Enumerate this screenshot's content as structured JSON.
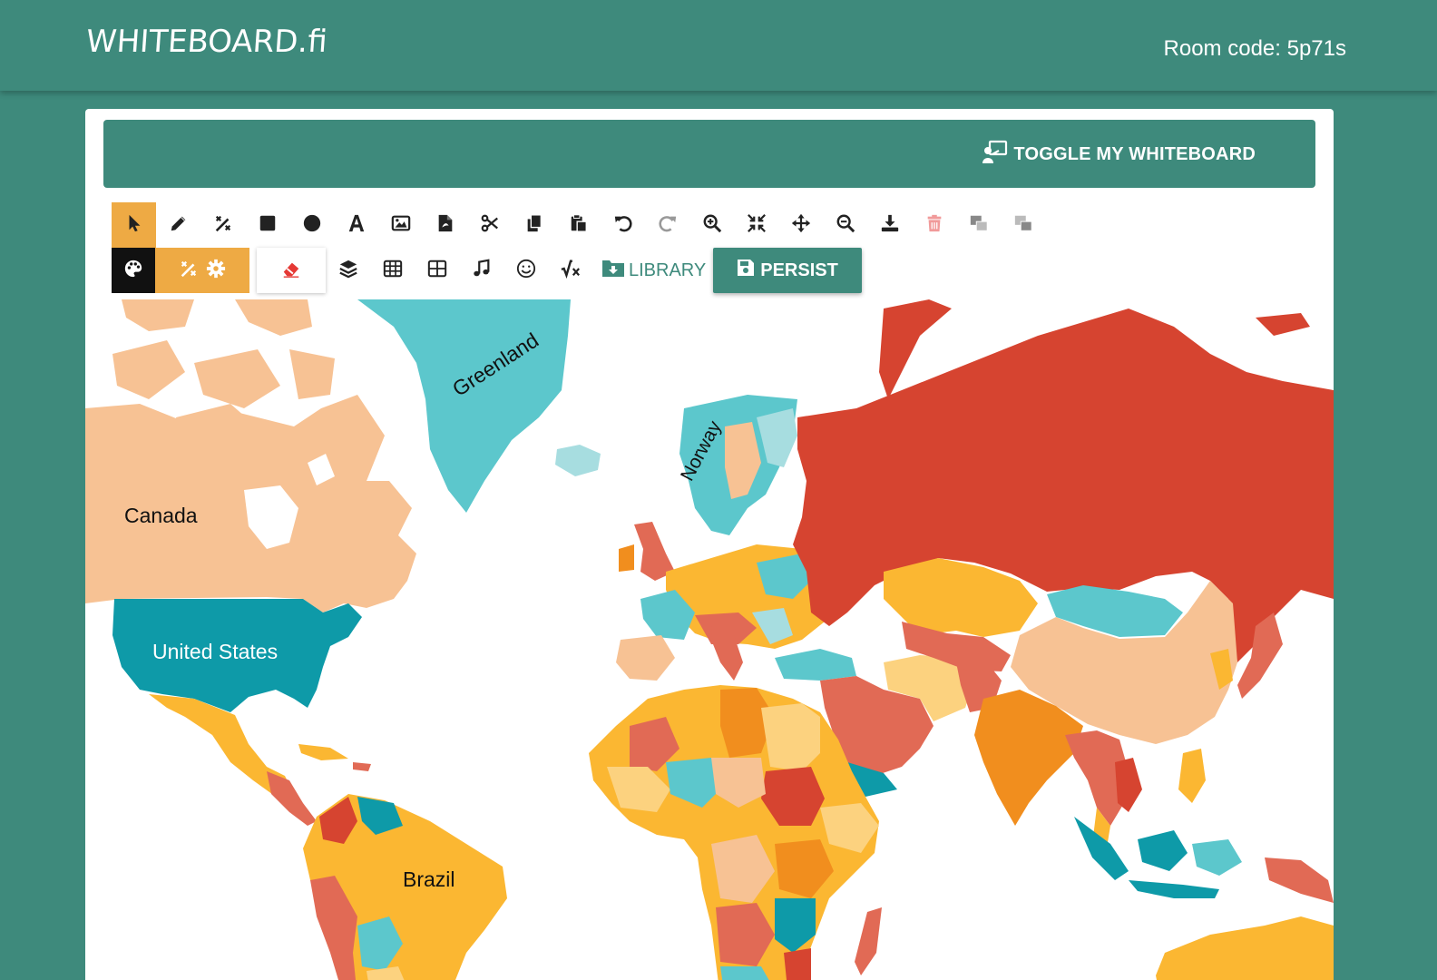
{
  "app": {
    "logo_text": "WHITEBOARD.fi",
    "room_code": "Room code: 5p71s"
  },
  "board": {
    "toggle_label": "TOGGLE MY WHITEBOARD"
  },
  "toolbar": {
    "tools": [
      "select-icon",
      "pencil-icon",
      "magic-pen-icon",
      "rectangle-icon",
      "circle-icon",
      "text-icon",
      "image-icon",
      "pdf-icon",
      "scissors-icon",
      "copy-icon",
      "paste-icon",
      "undo-icon",
      "redo-icon",
      "zoom-in-icon",
      "compress-icon",
      "move-icon",
      "zoom-out-icon",
      "download-icon",
      "trash-icon",
      "send-back-icon",
      "bring-front-icon"
    ],
    "active_tool": "select-icon",
    "library_label": "LIBRARY",
    "persist_label": "PERSIST"
  },
  "map": {
    "labels": {
      "canada": "Canada",
      "united_states": "United States",
      "greenland": "Greenland",
      "norway": "Norway",
      "brazil": "Brazil"
    }
  },
  "colors": {
    "brand": "#3e8a7c",
    "accent": "#eeaa44",
    "map_palette": [
      "#f7c294",
      "#0e9aa8",
      "#5cc7cc",
      "#fbb732",
      "#e16a55",
      "#d64430",
      "#f18e1e",
      "#fcd27f",
      "#a7dde0"
    ]
  }
}
